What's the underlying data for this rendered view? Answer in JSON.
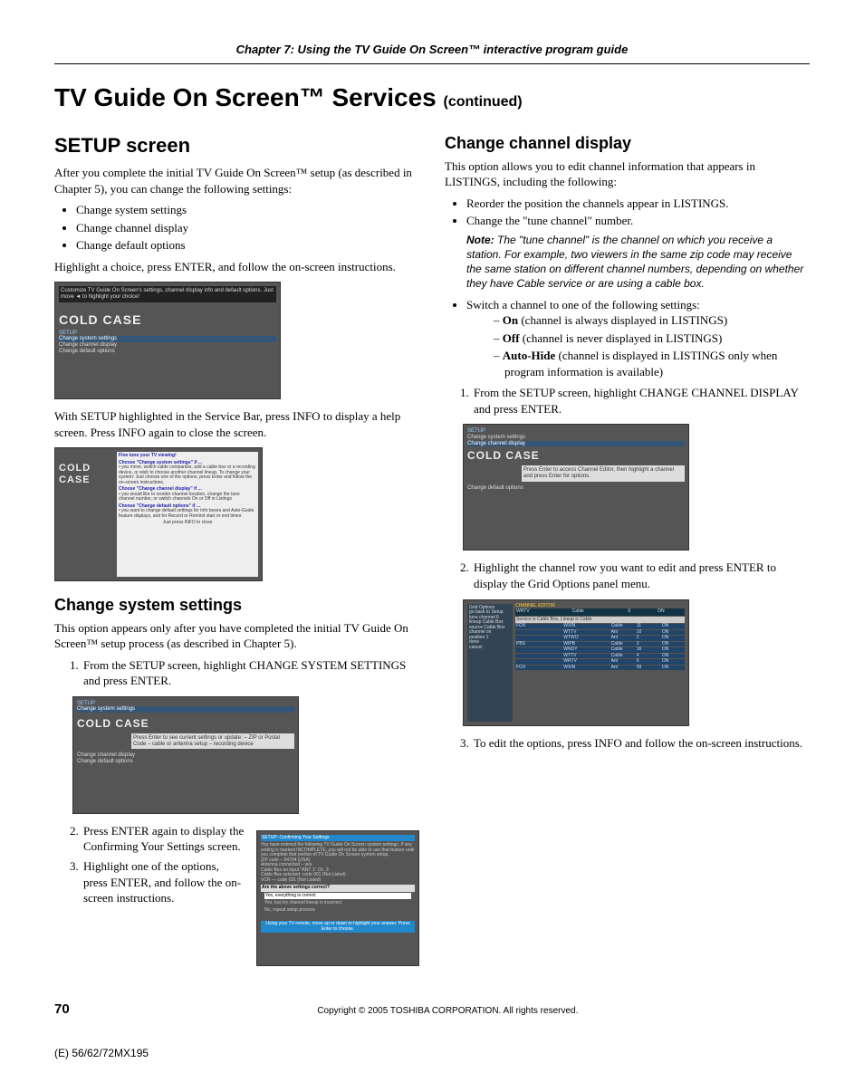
{
  "chapter_bar": "Chapter 7: Using the TV Guide On Screen™ interactive program guide",
  "page_title_main": "TV Guide On Screen™ Services ",
  "page_title_cont": "(continued)",
  "left": {
    "h2": "SETUP screen",
    "intro": "After you complete the initial TV Guide On Screen™ setup (as described in Chapter 5), you can change the following settings:",
    "bullets": [
      "Change system settings",
      "Change channel display",
      "Change default options"
    ],
    "after_bullets": "Highlight a choice, press ENTER, and follow the on-screen instructions.",
    "after_shot1": "With SETUP highlighted in the Service Bar, press INFO to display a help screen. Press INFO again to close the screen.",
    "h3": "Change system settings",
    "css_intro": "This option appears only after you have completed the initial TV Guide On Screen™ setup process (as described in Chapter 5).",
    "css_step1": "From the SETUP screen, highlight CHANGE SYSTEM SETTINGS and press ENTER.",
    "css_step2": "Press ENTER again to display the Confirming Your Settings screen.",
    "css_step3": "Highlight one of the options, press ENTER, and follow the on-screen instructions."
  },
  "right": {
    "h3": "Change channel display",
    "intro": "This option allows you to edit channel information that appears in LISTINGS, including the following:",
    "bullet1": "Reorder the position the channels appear in LISTINGS.",
    "bullet2": "Change the \"tune channel\" number.",
    "note_label": "Note:",
    "note_body": " The \"tune channel\" is the channel on which you receive a station. For example, two viewers in the same zip code may receive the same station on different channel numbers, depending on whether they have Cable service or are using a cable box.",
    "bullet3": "Switch a channel to one of the following settings:",
    "sub_on_bold": "On",
    "sub_on_rest": " (channel is always displayed in LISTINGS)",
    "sub_off_bold": "Off",
    "sub_off_rest": " (channel is never displayed in LISTINGS)",
    "sub_ah_bold": "Auto-Hide",
    "sub_ah_rest": " (channel is displayed in LISTINGS only when program information is available)",
    "step1": "From the SETUP screen, highlight CHANGE CHANNEL DISPLAY and press ENTER.",
    "step2": "Highlight the channel row you want to edit and press ENTER to display the Grid Options panel menu.",
    "step3": "To edit the options, press INFO and follow the on-screen instructions."
  },
  "shots": {
    "cold_case": "COLD CASE",
    "setup_menu": [
      "SETUP",
      "Change system settings",
      "Change channel display",
      "Change default options"
    ],
    "tip_box": "Customize TV Guide On Screen's settings, channel display info and default options. Just move ◄ to highlight your choice!",
    "help_title": "Fine tune your TV viewing!",
    "help_c1": "Choose \"Change system settings\" if ...",
    "help_c1_items": "• you move, switch cable companies, add a cable box or a recording device, or wish to choose another channel lineup.\nTo change your system: Just choose one of the options, press Enter and follow the on-screen instructions.",
    "help_c2": "Choose \"Change channel display\" if ...",
    "help_c2_items": "• you would like to reorder channel location, change the tune channel number, or switch channels On or Off in Listings",
    "help_c3": "Choose \"Change default options\" if ...",
    "help_c3_items": "• you want to change default settings for Info boxes and Auto-Guide feature displays, and for Record or Remind start or end times",
    "help_close": "Just press INFO to close",
    "css_tip": "Press Enter to see current settings or update:\n– ZIP or Postal Code\n– cable or antenna setup\n– recording device",
    "confirm_title": "SETUP: Confirming Your Settings",
    "confirm_body": "You have entered the following TV Guide On Screen system settings. If any setting is marked INCOMPLETE, you will not be able to use that feature until you complete that portion of TV Guide On Screen system setup.\nZIP code – 94704 (USA)\nAntenna connected – yes\nCable Box on input \"ANT 1\" Ch. 3\nCable Box selected: code 001 (Not Listed)\nVCR — code 031 (Not Listed)",
    "confirm_q": "Are the above settings correct?",
    "confirm_opts": [
      "Yes, everything is correct",
      "Yes, but my channel lineup is incorrect",
      "No, repeat setup process"
    ],
    "confirm_hint": "Using your TV remote, move up or down to highlight your answer. Press Enter to choose.",
    "ccd_tip": "Press Enter to access Channel Editor, then highlight a channel and press Enter for options.",
    "grid_title": "CHANNEL EDITOR",
    "grid_service": "Service is Cable Box, Lineup is Cable",
    "grid_panel": [
      "Grid Options",
      "go back to Setup",
      "tune channel   6",
      "lineup   Cable Box",
      "source  Cable Box",
      "channel   on",
      "position   1",
      "done",
      "cancel"
    ],
    "grid_head_row": [
      "WRTV",
      "Cable",
      "6",
      "ON"
    ],
    "grid_rows": [
      [
        "FOX",
        "WXIN",
        "Cable",
        "11",
        "ON"
      ],
      [
        "",
        "WTTV",
        "Ant",
        "10",
        "ON"
      ],
      [
        "",
        "WTWO",
        "Ant",
        "2",
        "ON"
      ],
      [
        "PBS",
        "WIPB",
        "Cable",
        "3",
        "ON"
      ],
      [
        "",
        "WNDY",
        "Cable",
        "16",
        "ON"
      ],
      [
        "",
        "WTTV",
        "Cable",
        "4",
        "ON"
      ],
      [
        "",
        "WRTV",
        "Ant",
        "6",
        "ON"
      ],
      [
        "FOX",
        "WXIN",
        "Ant",
        "59",
        "ON"
      ]
    ]
  },
  "footer": {
    "page": "70",
    "copyright": "Copyright © 2005 TOSHIBA CORPORATION. All rights reserved.",
    "doc_code": "(E) 56/62/72MX195"
  }
}
